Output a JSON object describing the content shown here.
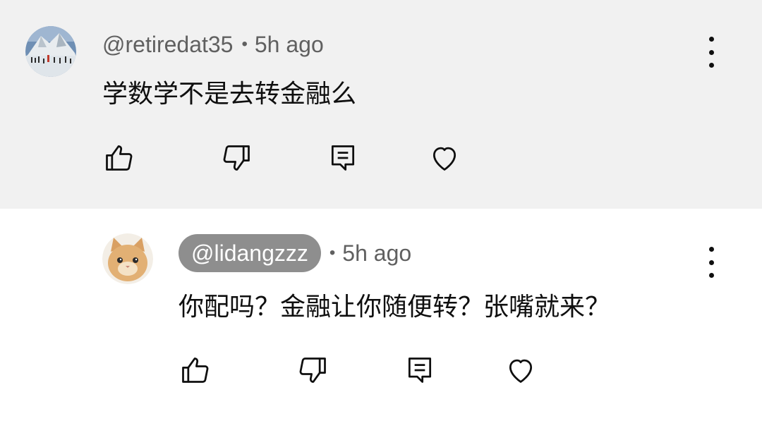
{
  "comments": [
    {
      "handle": "@retiredat35",
      "time": "5h ago",
      "text": "学数学不是去转金融么",
      "avatar": "snowy-mountain-photo",
      "actions": [
        "like-icon",
        "dislike-icon",
        "reply-icon",
        "heart-icon"
      ],
      "background": "#f1f1f1"
    },
    {
      "handle": "@lidangzzz",
      "time": "5h ago",
      "text": "你配吗？金融让你随便转？张嘴就来？",
      "avatar": "cat-photo",
      "handle_highlighted": true,
      "actions": [
        "like-icon",
        "dislike-icon",
        "reply-icon",
        "heart-icon"
      ],
      "background": "#ffffff"
    }
  ],
  "separator": "•"
}
